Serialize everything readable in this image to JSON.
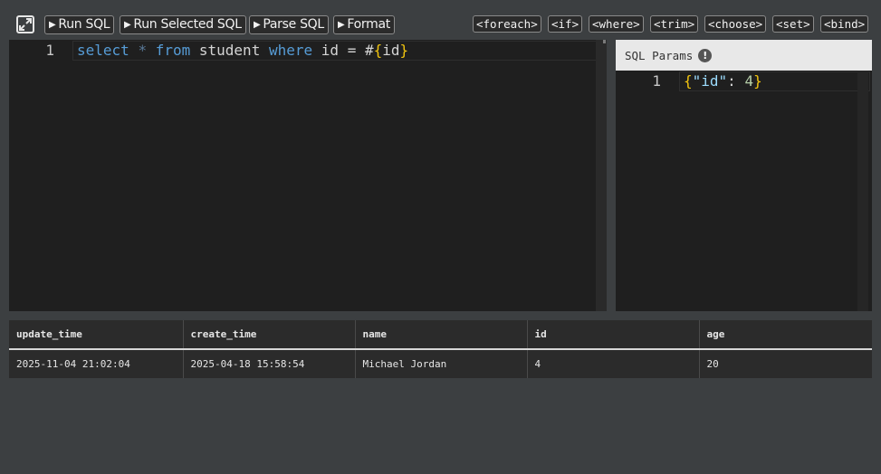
{
  "toolbar": {
    "expand_icon": "expand-icon",
    "buttons": [
      {
        "label": "Run SQL"
      },
      {
        "label": "Run Selected SQL"
      },
      {
        "label": "Parse SQL"
      },
      {
        "label": "Format"
      }
    ],
    "tags": [
      "<foreach>",
      "<if>",
      "<where>",
      "<trim>",
      "<choose>",
      "<set>",
      "<bind>"
    ]
  },
  "sql_editor": {
    "line_number": "1",
    "tokens": {
      "select": "select",
      "star": "*",
      "from": "from",
      "table": "student",
      "where": "where",
      "col": "id",
      "eq": "=",
      "hash": "#",
      "open": "{",
      "param": "id",
      "close": "}"
    }
  },
  "params_panel": {
    "title": "SQL Params",
    "info_icon": "!",
    "line_number": "1",
    "tokens": {
      "open": "{",
      "key": "\"id\"",
      "colon": ":",
      "value": "4",
      "close": "}"
    }
  },
  "results": {
    "columns": [
      "update_time",
      "create_time",
      "name",
      "id",
      "age"
    ],
    "rows": [
      [
        "2025-11-04 21:02:04",
        "2025-04-18 15:58:54",
        "Michael Jordan",
        "4",
        "20"
      ]
    ]
  },
  "colors": {
    "background": "#3c3f41",
    "editor_bg": "#1f1f1f",
    "keyword": "#569cd6",
    "brace": "#f1c40f",
    "number": "#b5cea8"
  }
}
